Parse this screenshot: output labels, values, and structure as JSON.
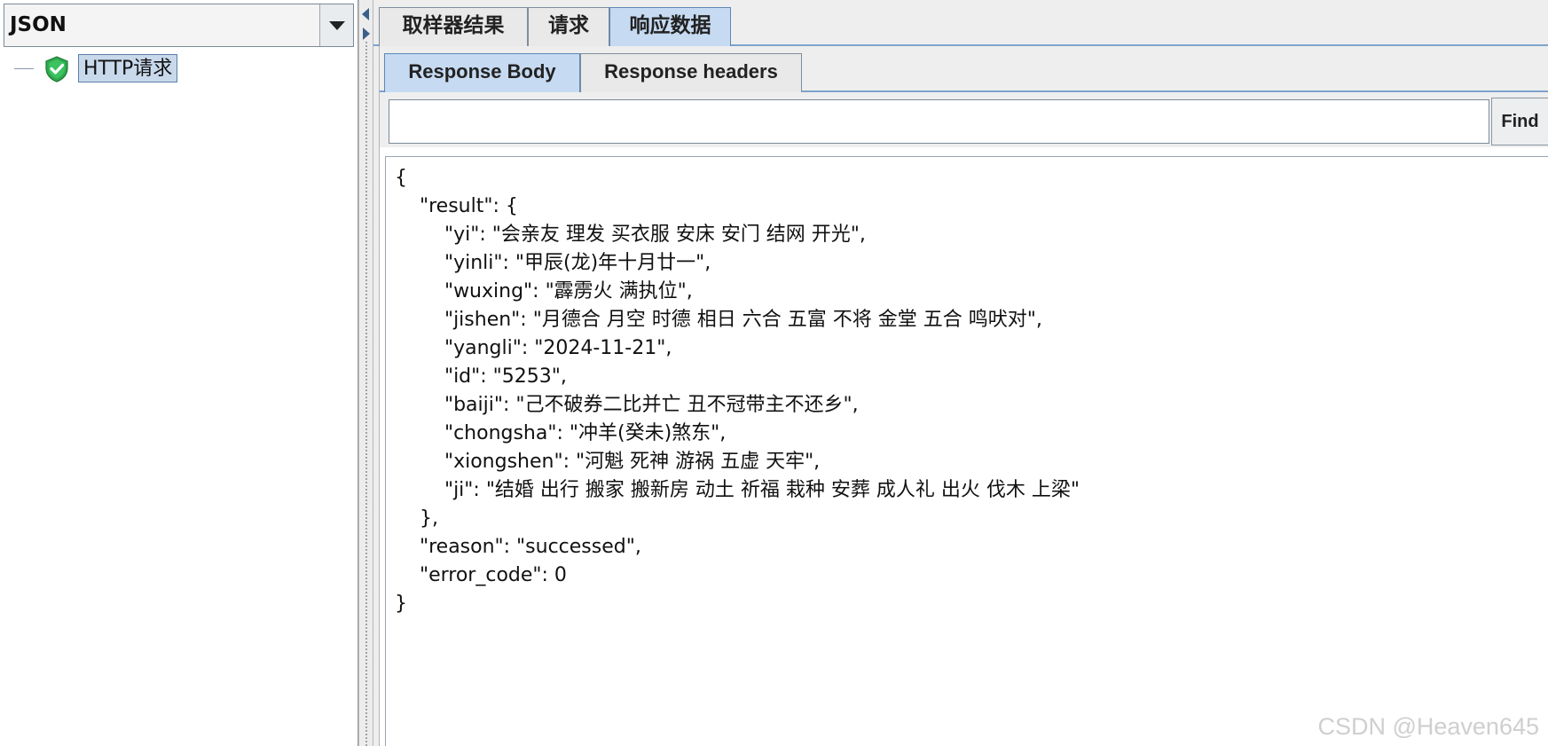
{
  "left_panel": {
    "renderer_select": {
      "value": "JSON"
    },
    "tree": {
      "items": [
        {
          "label": "HTTP请求",
          "status": "success"
        }
      ]
    }
  },
  "main_tabs": [
    {
      "label": "取样器结果",
      "active": false
    },
    {
      "label": "请求",
      "active": false
    },
    {
      "label": "响应数据",
      "active": true
    }
  ],
  "sub_tabs": [
    {
      "label": "Response Body",
      "active": true
    },
    {
      "label": "Response headers",
      "active": false
    }
  ],
  "find": {
    "value": "",
    "button_label": "Find"
  },
  "response_lines": [
    "{",
    "    \"result\": {",
    "        \"yi\": \"会亲友 理发 买衣服 安床 安门 结网 开光\",",
    "        \"yinli\": \"甲辰(龙)年十月廿一\",",
    "        \"wuxing\": \"霹雳火 满执位\",",
    "        \"jishen\": \"月德合 月空 时德 相日 六合 五富 不将 金堂 五合 鸣吠对\",",
    "        \"yangli\": \"2024-11-21\",",
    "        \"id\": \"5253\",",
    "        \"baiji\": \"己不破券二比并亡 丑不冠带主不还乡\",",
    "        \"chongsha\": \"冲羊(癸未)煞东\",",
    "        \"xiongshen\": \"河魁 死神 游祸 五虚 天牢\",",
    "        \"ji\": \"结婚 出行 搬家 搬新房 动土 祈福 栽种 安葬 成人礼 出火 伐木 上梁\"",
    "    },",
    "    \"reason\": \"successed\",",
    "    \"error_code\": 0",
    "}"
  ],
  "watermark": "CSDN @Heaven645",
  "colors": {
    "selected_tab": "#c6daf2",
    "tab_border_active": "#5f87b5",
    "tree_selection": "#c9d9ec",
    "success_icon": "#2fa84f"
  }
}
